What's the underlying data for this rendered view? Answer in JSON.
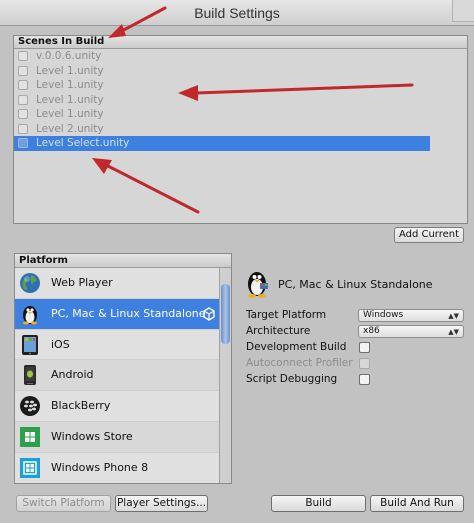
{
  "window": {
    "title": "Build Settings"
  },
  "scenes": {
    "header": "Scenes In Build",
    "items": [
      {
        "label": "v.0.0.6.unity",
        "checked": false
      },
      {
        "label": "Level 1.unity",
        "checked": false
      },
      {
        "label": "Level 1.unity",
        "checked": false
      },
      {
        "label": "Level 1.unity",
        "checked": false
      },
      {
        "label": "Level 1.unity",
        "checked": false
      },
      {
        "label": "Level 2.unity",
        "checked": false
      },
      {
        "label": "Level Select.unity",
        "checked": false,
        "selected": true
      }
    ],
    "add_current_label": "Add Current"
  },
  "platform": {
    "header": "Platform",
    "items": [
      {
        "label": "Web Player",
        "icon": "globe-icon"
      },
      {
        "label": "PC, Mac & Linux Standalone",
        "icon": "tux-icon",
        "selected": true
      },
      {
        "label": "iOS",
        "icon": "ipad-icon"
      },
      {
        "label": "Android",
        "icon": "android-phone-icon"
      },
      {
        "label": "BlackBerry",
        "icon": "blackberry-icon"
      },
      {
        "label": "Windows Store",
        "icon": "windows-store-icon"
      },
      {
        "label": "Windows Phone 8",
        "icon": "windows-phone-icon"
      }
    ]
  },
  "settings": {
    "title": "PC, Mac & Linux Standalone",
    "target_platform": {
      "label": "Target Platform",
      "value": "Windows"
    },
    "architecture": {
      "label": "Architecture",
      "value": "x86"
    },
    "development_build": {
      "label": "Development Build",
      "checked": false
    },
    "autoconnect_profiler": {
      "label": "Autoconnect Profiler",
      "checked": false,
      "disabled": true
    },
    "script_debugging": {
      "label": "Script Debugging",
      "checked": false
    }
  },
  "buttons": {
    "switch_platform": "Switch Platform",
    "player_settings": "Player Settings...",
    "build": "Build",
    "build_and_run": "Build And Run"
  },
  "colors": {
    "selection": "#3d80df",
    "annotation_arrow": "#c0282b"
  }
}
